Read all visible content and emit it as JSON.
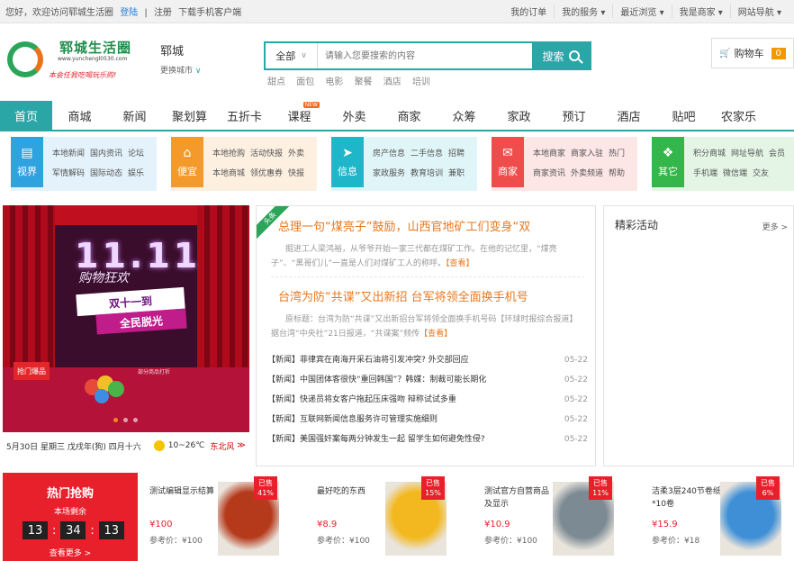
{
  "topbar": {
    "welcome": "您好，欢迎访问郓城生活圈",
    "login": "登陆",
    "register": "注册",
    "app": "下载手机客户端",
    "links": [
      "我的订单",
      "我的服务 ▾",
      "最近浏览 ▾",
      "我是商家 ▾",
      "网站导航 ▾"
    ]
  },
  "header": {
    "logo_title": "郓城生活圈",
    "logo_url": "www.yunchengl0530.com",
    "logo_slogan": "本会任我吃喝玩乐购!",
    "city": "郓城",
    "switch_city": "更换城市",
    "search_category": "全部",
    "search_placeholder": "请输入您要搜索的内容",
    "search_button": "搜索",
    "hot_words": [
      "甜点",
      "面包",
      "电影",
      "聚餐",
      "酒店",
      "培训"
    ],
    "cart_label": "购物车",
    "cart_count": "0"
  },
  "nav": {
    "items": [
      "首页",
      "商城",
      "新闻",
      "聚划算",
      "五折卡",
      "课程",
      "外卖",
      "商家",
      "众筹",
      "家政",
      "预订",
      "酒店",
      "贴吧",
      "农家乐"
    ],
    "hot_tag": "NEW"
  },
  "categories": [
    {
      "label": "视界",
      "color": "#2fa3e0",
      "bg": "#e4f2fb",
      "links": [
        [
          "本地新闻",
          "国内资讯",
          "论坛"
        ],
        [
          "军情解码",
          "国际动态",
          "娱乐"
        ]
      ]
    },
    {
      "label": "便宜",
      "color": "#f39a2b",
      "bg": "#fdf0e1",
      "links": [
        [
          "本地抢购",
          "活动快报",
          "外卖"
        ],
        [
          "本地商城",
          "领优惠券",
          "快报"
        ]
      ]
    },
    {
      "label": "信息",
      "color": "#20b6c9",
      "bg": "#e0f5f7",
      "links": [
        [
          "房产信息",
          "二手信息",
          "招聘"
        ],
        [
          "家政服务",
          "教育培训",
          "兼职"
        ]
      ]
    },
    {
      "label": "商家",
      "color": "#ef4c4c",
      "bg": "#fde6e6",
      "links": [
        [
          "本地商家",
          "商家入驻",
          "热门"
        ],
        [
          "商家资讯",
          "外卖频道",
          "帮助"
        ]
      ]
    },
    {
      "label": "其它",
      "color": "#35b64a",
      "bg": "#e4f5e5",
      "links": [
        [
          "积分商城",
          "网址导航",
          "会员"
        ],
        [
          "手机端",
          "微信端",
          "交友"
        ]
      ]
    }
  ],
  "banner": {
    "big": "11.11",
    "sub": "购物狂欢",
    "tag1": "双十一到",
    "tag2": "全民脱光",
    "stage_label": "抢门爆品",
    "stage_text": "部分商品打折"
  },
  "weather": {
    "date": "5月30日 星期三 戊戌年(狗) 四月十六",
    "temp": "10~26℃",
    "wind": "东北风"
  },
  "news": {
    "ribbon": "头条",
    "headline1": "总理一句“煤亮子”鼓励，山西官地矿工们变身“双",
    "summary1": "掘进工人梁鸿裕，从爷爷开始一家三代都在煤矿工作。在他的记忆里，“煤亮子”、“黑哥们儿”一直是人们对煤矿工人的称呼。",
    "more1": "【查看】",
    "headline2": "台湾为防“共谍”又出新招 台军将领全面换手机号",
    "summary2": "原标题：台湾为防“共谍”又出新招台军将领全面换手机号码【环球时报综合报道】据台湾“中央社”21日报道，“共谍案”频传",
    "more2": "【查看】",
    "items": [
      {
        "title": "【新闻】菲律宾在南海开采石油将引发冲突? 外交部回应",
        "date": "05-22"
      },
      {
        "title": "【新闻】中国团体客很快“重回韩国”？韩媒：制裁可能长期化",
        "date": "05-22"
      },
      {
        "title": "【新闻】快递员将女客户拖起压床强吻 辩称试试多重",
        "date": "05-22"
      },
      {
        "title": "【新闻】互联网新闻信息服务许可管理实施细则",
        "date": "05-22"
      },
      {
        "title": "【新闻】美国强奸案每两分钟发生一起 留学生如何避免性侵?",
        "date": "05-22"
      }
    ]
  },
  "activity": {
    "title": "精彩活动",
    "more": "更多 >"
  },
  "flash": {
    "title": "热门抢购",
    "subtitle": "本场剩余",
    "h": "13",
    "m": "34",
    "s": "13",
    "more": "查看更多 >"
  },
  "products": [
    {
      "name": "测试编辑显示结算",
      "price": "¥100",
      "ref": "参考价：¥100",
      "sold": "已售",
      "pct": "41%",
      "img_color": "#b5391b"
    },
    {
      "name": "最好吃的东西",
      "price": "¥8.9",
      "ref": "参考价：¥100",
      "sold": "已售",
      "pct": "15%",
      "img_color": "#f3b81f"
    },
    {
      "name": "测试官方自营商品及显示",
      "price": "¥10.9",
      "ref": "参考价：¥100",
      "sold": "已售",
      "pct": "11%",
      "img_color": "#7c8a94"
    },
    {
      "name": "洁柔3层240节卷纸*10卷",
      "price": "¥15.9",
      "ref": "参考价：¥18",
      "sold": "已售",
      "pct": "6%",
      "img_color": "#3e8fd6"
    }
  ]
}
